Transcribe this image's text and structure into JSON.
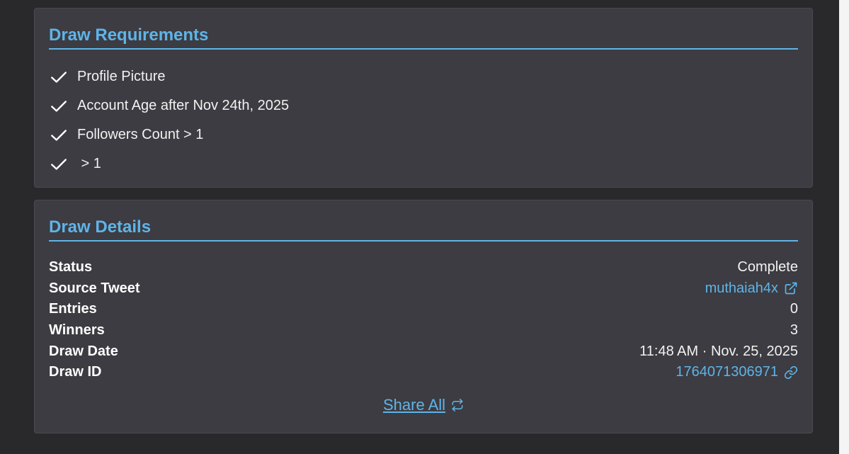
{
  "requirements": {
    "title": "Draw Requirements",
    "items": [
      {
        "label": "Profile Picture",
        "icon": "check-icon"
      },
      {
        "label": "Account Age after Nov 24th, 2025",
        "icon": "check-icon"
      },
      {
        "label": "Followers Count > 1",
        "icon": "check-icon"
      },
      {
        "label": " > 1",
        "icon": "check-icon"
      }
    ]
  },
  "details": {
    "title": "Draw Details",
    "status_label": "Status",
    "status_value": "Complete",
    "source_label": "Source Tweet",
    "source_value": "muthaiah4x",
    "entries_label": "Entries",
    "entries_value": "0",
    "winners_label": "Winners",
    "winners_value": "3",
    "date_label": "Draw Date",
    "date_value": "11:48 AM · Nov. 25, 2025",
    "id_label": "Draw ID",
    "id_value": "1764071306971",
    "share_label": "Share All"
  },
  "colors": {
    "accent": "#5fb4e8",
    "background": "#29292c",
    "card": "#3c3c42",
    "text": "#f2f2f2"
  }
}
